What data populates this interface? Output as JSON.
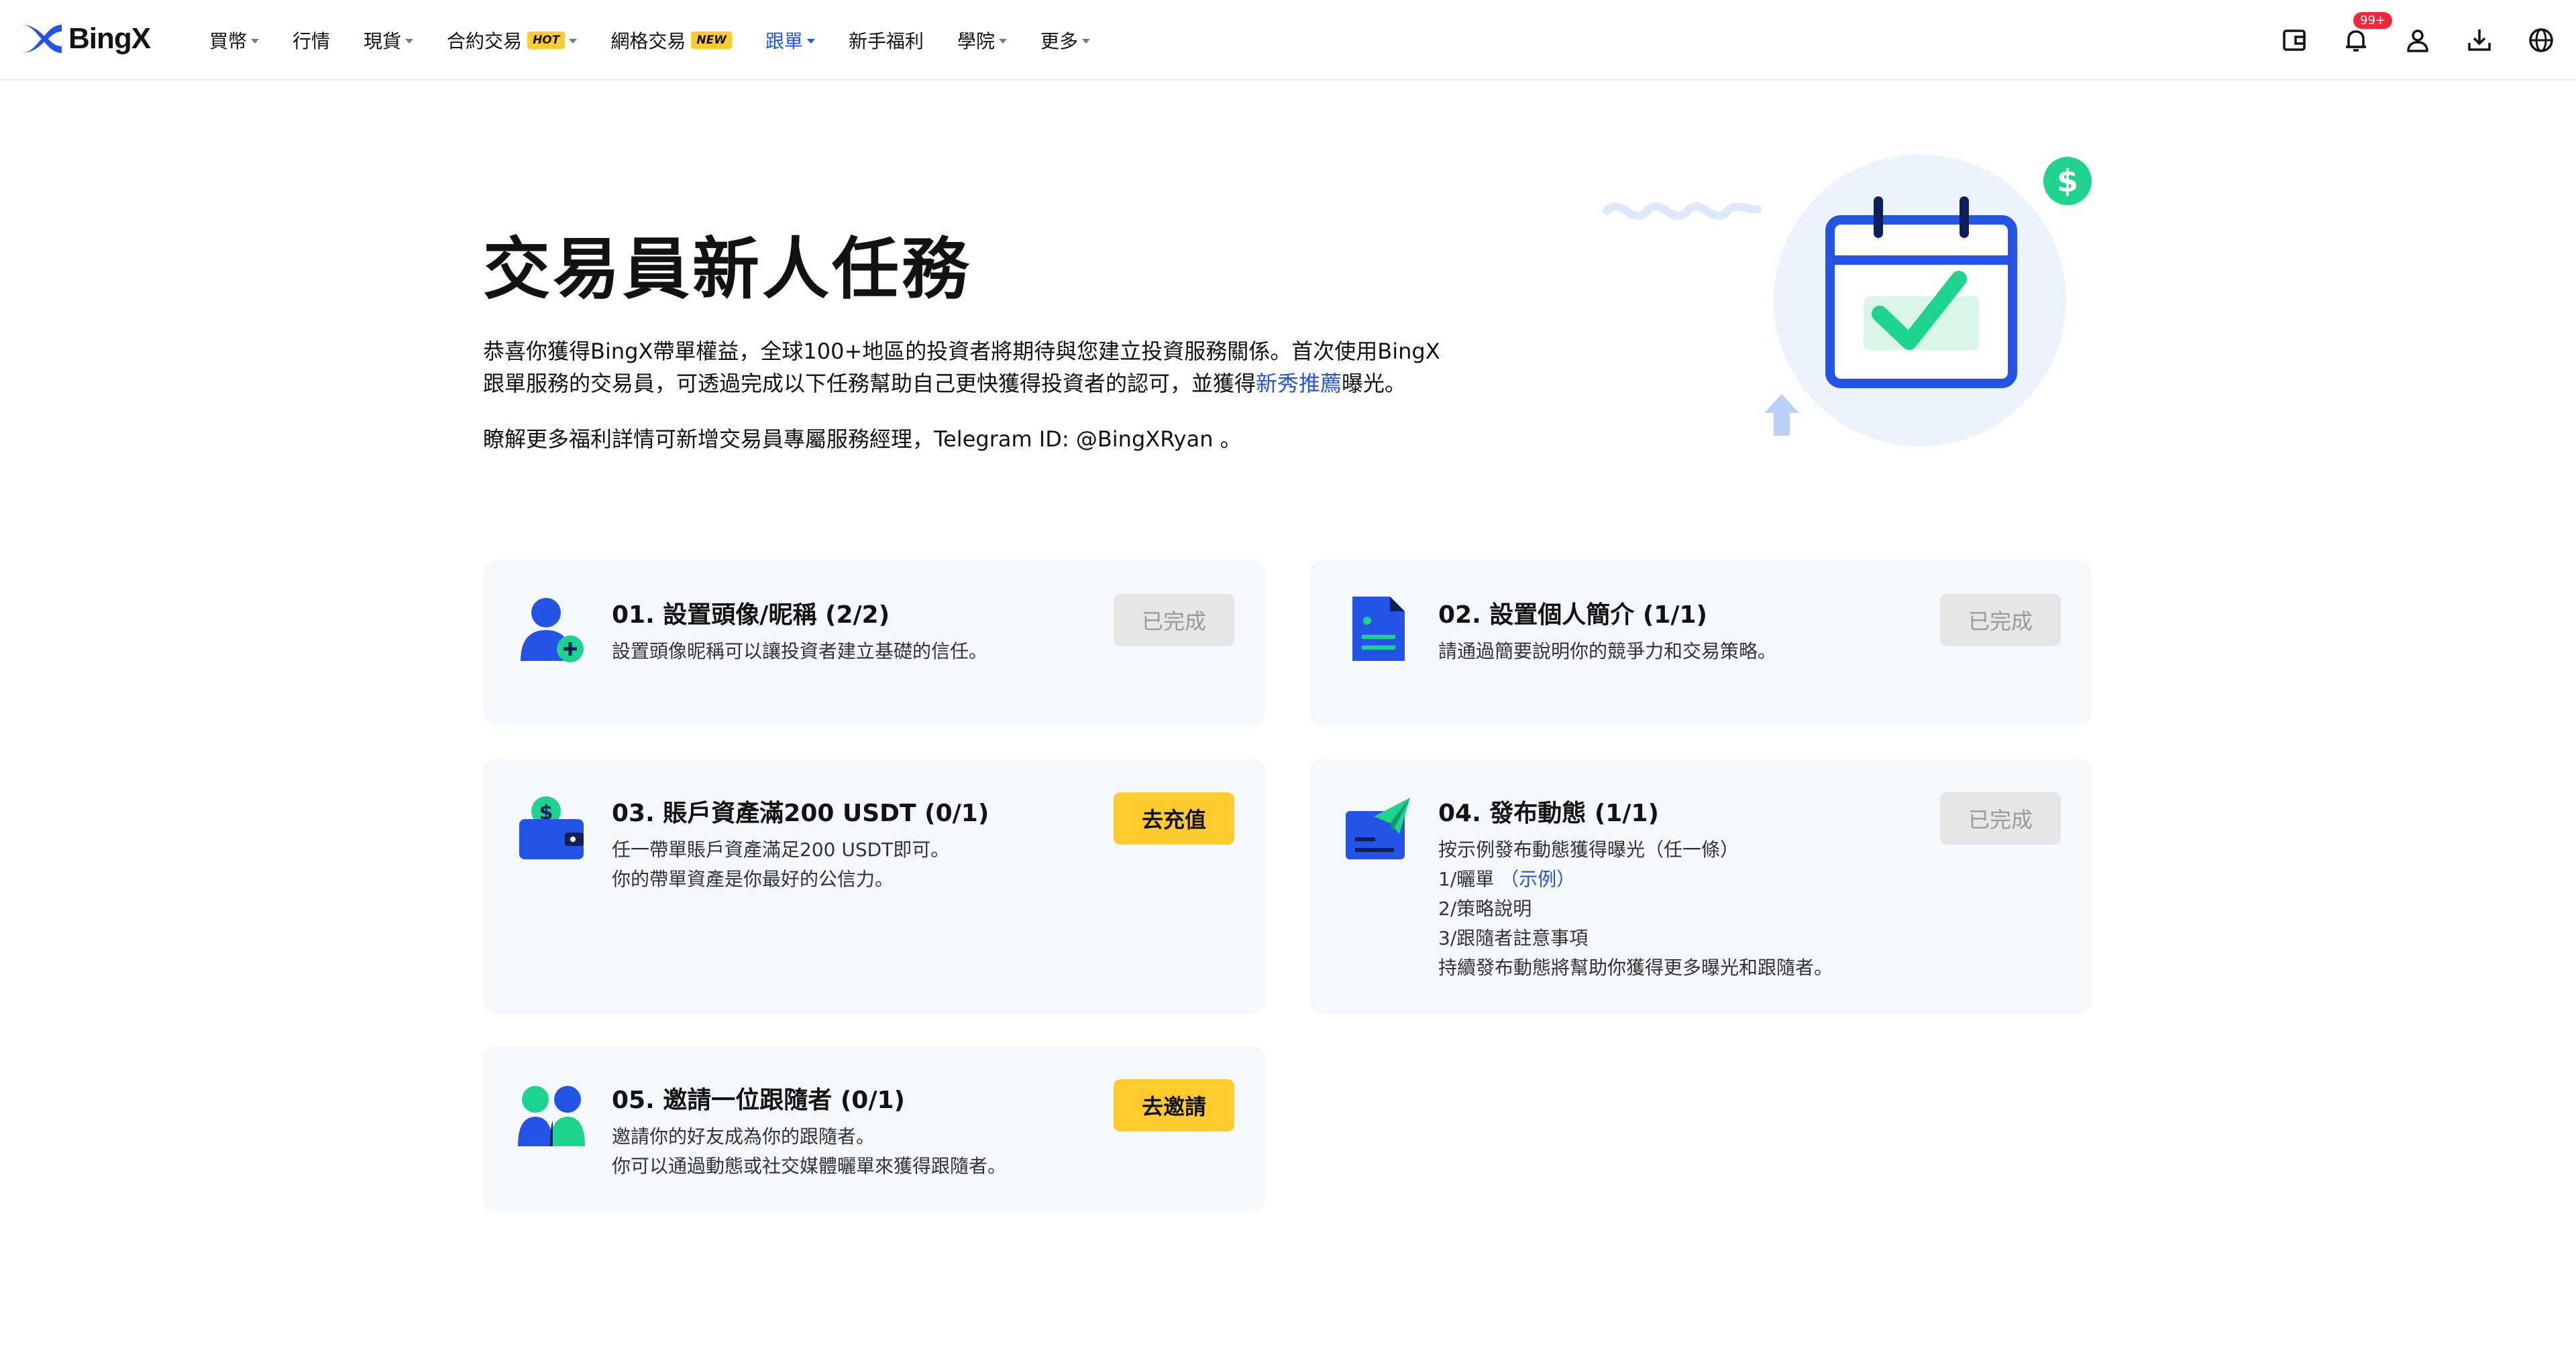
{
  "nav": {
    "logo_text": "BingX",
    "items": [
      {
        "label": "買幣",
        "caret": true
      },
      {
        "label": "行情",
        "caret": false
      },
      {
        "label": "現貨",
        "caret": true
      },
      {
        "label": "合約交易",
        "tag": "HOT",
        "caret": true
      },
      {
        "label": "網格交易",
        "tag": "NEW",
        "caret": false
      },
      {
        "label": "跟單",
        "caret": true,
        "active": true
      },
      {
        "label": "新手福利",
        "caret": false
      },
      {
        "label": "學院",
        "caret": true
      },
      {
        "label": "更多",
        "caret": true
      }
    ],
    "notification_badge": "99+",
    "icons": [
      "wallet-icon",
      "bell-icon",
      "user-icon",
      "download-icon",
      "globe-icon"
    ],
    "accent_color": "#2354e6"
  },
  "hero": {
    "title": "交易員新人任務",
    "desc_part1": "恭喜你獲得BingX帶單權益，全球100+地區的投資者將期待與您建立投資服務關係。首次使用BingX跟單服務的交易員，可透過完成以下任務幫助自己更快獲得投資者的認可，並獲得",
    "desc_link": "新秀推薦",
    "desc_part2": "曝光。",
    "note": "瞭解更多福利詳情可新增交易員專屬服務經理，Telegram ID: @BingXRyan 。"
  },
  "tasks": {
    "t1": {
      "title": "01. 設置頭像/昵稱 (2/2)",
      "lines": [
        "設置頭像昵稱可以讓投資者建立基礎的信任。"
      ],
      "button": "已完成",
      "status": "done"
    },
    "t2": {
      "title": "02. 設置個人簡介 (1/1)",
      "lines": [
        "請通過簡要說明你的競爭力和交易策略。"
      ],
      "button": "已完成",
      "status": "done"
    },
    "t3": {
      "title": "03. 賬戶資產滿200 USDT (0/1)",
      "lines": [
        "任一帶單賬戶資產滿足200 USDT即可。",
        "你的帶單資產是你最好的公信力。"
      ],
      "button": "去充值",
      "status": "todo"
    },
    "t4": {
      "title": "04. 發布動態 (1/1)",
      "line1": "按示例發布動態獲得曝光（任一條）",
      "line2_prefix": "1/曬單 ",
      "line2_link": "（示例）",
      "line3": "2/策略說明",
      "line4": "3/跟隨者註意事項",
      "line5": "持續發布動態將幫助你獲得更多曝光和跟隨者。",
      "button": "已完成",
      "status": "done"
    },
    "t5": {
      "title": "05. 邀請一位跟隨者 (0/1)",
      "lines": [
        "邀請你的好友成為你的跟隨者。",
        "你可以通過動態或社交媒體曬單來獲得跟隨者。"
      ],
      "button": "去邀請",
      "status": "todo"
    }
  },
  "colors": {
    "blue": "#2354e6",
    "green": "#1ed38d",
    "yellow": "#ffcb2d",
    "card_bg": "#f5f8fc"
  }
}
